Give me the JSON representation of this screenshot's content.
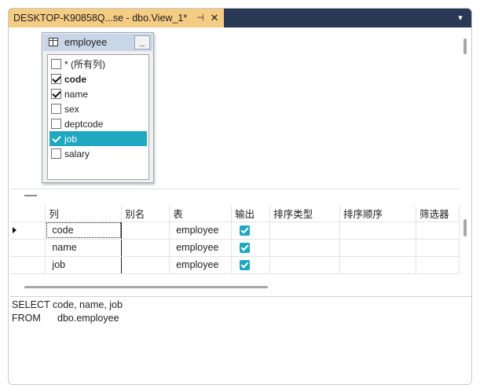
{
  "tab": {
    "title": "DESKTOP-K90858Q...se - dbo.View_1*",
    "pin_glyph": "⊣",
    "close_glyph": "✕",
    "dropdown_glyph": "▾"
  },
  "diagram": {
    "table_name": "employee",
    "minimize_glyph": "_",
    "columns": [
      {
        "label": "* (所有列)",
        "checked": false,
        "bold": false,
        "selected": false
      },
      {
        "label": "code",
        "checked": true,
        "bold": true,
        "selected": false
      },
      {
        "label": "name",
        "checked": true,
        "bold": false,
        "selected": false
      },
      {
        "label": "sex",
        "checked": false,
        "bold": false,
        "selected": false
      },
      {
        "label": "deptcode",
        "checked": false,
        "bold": false,
        "selected": false
      },
      {
        "label": "job",
        "checked": true,
        "bold": false,
        "selected": true
      },
      {
        "label": "salary",
        "checked": false,
        "bold": false,
        "selected": false
      }
    ]
  },
  "grid": {
    "headers": {
      "column": "列",
      "alias": "别名",
      "table": "表",
      "output": "输出",
      "sort_type": "排序类型",
      "sort_order": "排序顺序",
      "filter": "筛选器"
    },
    "rows": [
      {
        "column": "code",
        "alias": "",
        "table": "employee",
        "output": true,
        "current": true
      },
      {
        "column": "name",
        "alias": "",
        "table": "employee",
        "output": true,
        "current": false
      },
      {
        "column": "job",
        "alias": "",
        "table": "employee",
        "output": true,
        "current": false
      }
    ]
  },
  "sql": {
    "line1_keyword": "SELECT",
    "line1_body": "code, name, job",
    "line2_keyword": "FROM",
    "line2_body": "dbo.employee"
  },
  "colors": {
    "tab_active": "#f5cc84",
    "tabstrip": "#293955",
    "selection": "#1fa8c0",
    "table_header": "#c9d6e8"
  }
}
